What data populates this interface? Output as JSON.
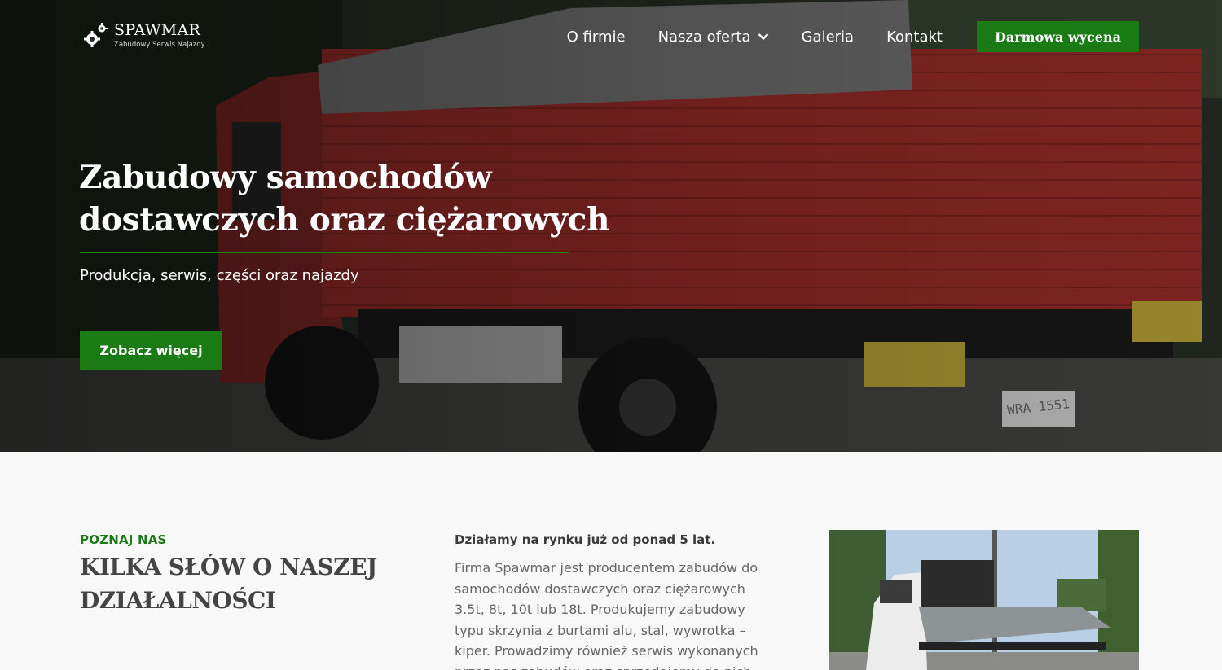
{
  "header": {
    "logo_name": "SPAWMAR",
    "logo_tagline": "Zabudowy Serwis Najazdy",
    "nav": [
      {
        "label": "O firmie"
      },
      {
        "label": "Nasza oferta",
        "has_dropdown": true
      },
      {
        "label": "Galeria"
      },
      {
        "label": "Kontakt"
      }
    ],
    "cta_label": "Darmowa wycena"
  },
  "hero": {
    "title_line1": "Zabudowy samochodów",
    "title_line2": "dostawczych oraz ciężarowych",
    "subtitle": "Produkcja, serwis, części oraz najazdy",
    "button_label": "Zobacz więcej",
    "plate_text": "WRA 1551"
  },
  "about": {
    "eyebrow": "POZNAJ NAS",
    "title_line1": "KILKA SŁÓW O NASZEJ",
    "title_line2": "DZIAŁALNOŚCI",
    "lead": "Działamy na rynku już od ponad 5 lat.",
    "body": "Firma Spawmar jest producentem zabudów do samochodów dostawczych oraz ciężarowych 3.5t, 8t, 10t lub 18t. Produkujemy zabudowy typu skrzynia z burtami alu, stal, wywrotka – kiper. Prowadzimy również serwis wykonanych przez nas zabudów oraz sprzedajemy do nich"
  },
  "colors": {
    "accent_green": "#1a7a14",
    "hero_overlay": "#000000",
    "truck_red": "#b2322e"
  },
  "icons": {
    "logo": "gear-icon",
    "dropdown": "chevron-down-icon"
  }
}
